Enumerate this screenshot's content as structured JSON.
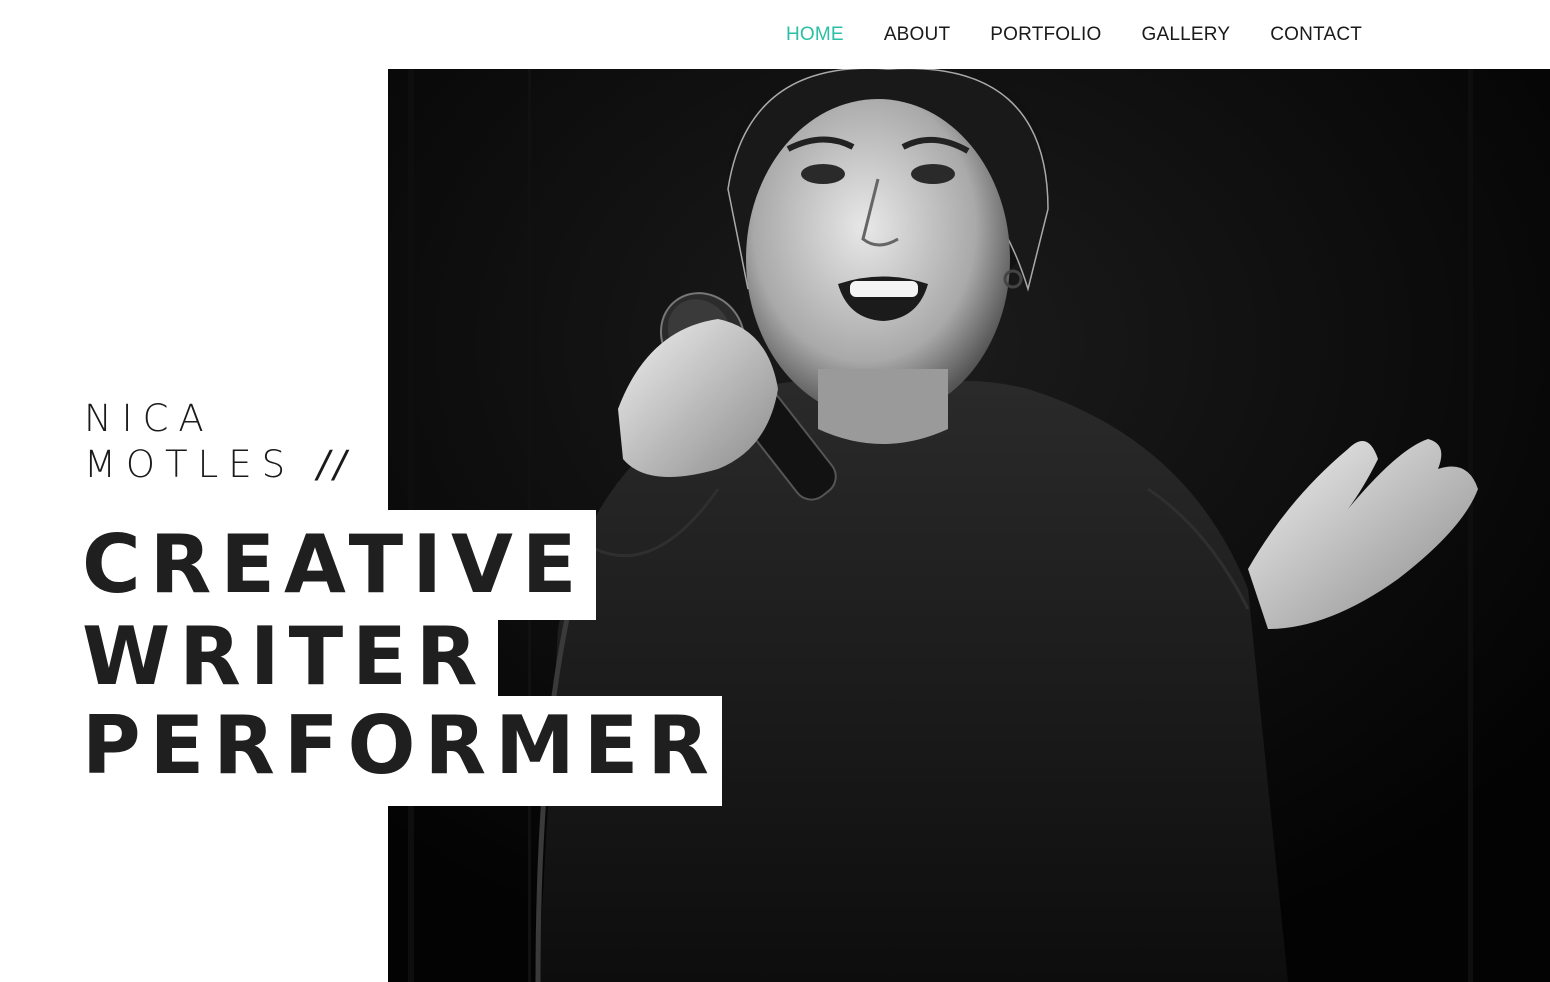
{
  "nav": {
    "items": [
      {
        "label": "HOME",
        "active": true
      },
      {
        "label": "ABOUT",
        "active": false
      },
      {
        "label": "PORTFOLIO",
        "active": false
      },
      {
        "label": "GALLERY",
        "active": false
      },
      {
        "label": "CONTACT",
        "active": false
      }
    ],
    "active_color": "#2bbfa5"
  },
  "hero": {
    "name_line1": "NICA",
    "name_line2": "MOTLES",
    "name_suffix": "//",
    "title_lines": [
      "CREATIVE",
      "WRITER",
      "PERFORMER"
    ],
    "photo_icon": "performer-photo"
  }
}
